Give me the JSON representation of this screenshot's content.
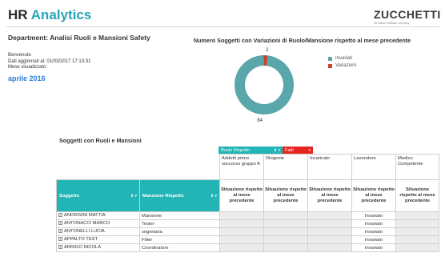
{
  "header": {
    "title_part1": "HR",
    "title_part2": "Analytics",
    "logo_main": "ZUCCHETTI",
    "logo_sub": "the italian software company"
  },
  "info": {
    "department": "Department: Analisi Ruoli e Mansioni Safety",
    "welcome": "Benvenuto",
    "updated": "Dati aggiornati al: 01/03/2017 17:13:31",
    "month_label": "Mese visualizzato :",
    "month_value": "aprile 2016"
  },
  "chart_data": {
    "type": "pie",
    "title": "Numero Soggetti con Variazioni di Ruolo/Mansione rispetto al mese precedente",
    "categories": [
      "Invariati",
      "Variazioni"
    ],
    "values": [
      84,
      2
    ],
    "colors": [
      "#5aa7ab",
      "#c8442f"
    ],
    "legend_position": "right"
  },
  "table": {
    "title": "Soggetti con Ruoli e Mansioni",
    "filters": [
      {
        "label": "Ruolo Rispetto",
        "color": "#23b5b5"
      },
      {
        "label": "Fatti",
        "color": "#e52620"
      }
    ],
    "col_soggetto": "Soggetto",
    "col_mansione": "Mansione Rispetto",
    "roles": [
      "Addetti primo soccorso gruppo A",
      "Dirigente",
      "Incaricato",
      "Lavoratore",
      "Medico Competente"
    ],
    "situation_label": "Situazione rispetto al mese precedente",
    "rows": [
      {
        "name": "ANDRISINI MATTIA",
        "mansione": "Mansione",
        "status": "Invariato"
      },
      {
        "name": "ANTONACCI MARCO",
        "mansione": "Tester",
        "status": "Invariato"
      },
      {
        "name": "ANTONELLI LUCIA",
        "mansione": "segretaria",
        "status": "Invariato"
      },
      {
        "name": "APPALTO TEST",
        "mansione": "Fitter",
        "status": "Invariato"
      },
      {
        "name": "ARRIGO NICOLA",
        "mansione": "Coordinatore",
        "status": "Invariato"
      }
    ]
  }
}
